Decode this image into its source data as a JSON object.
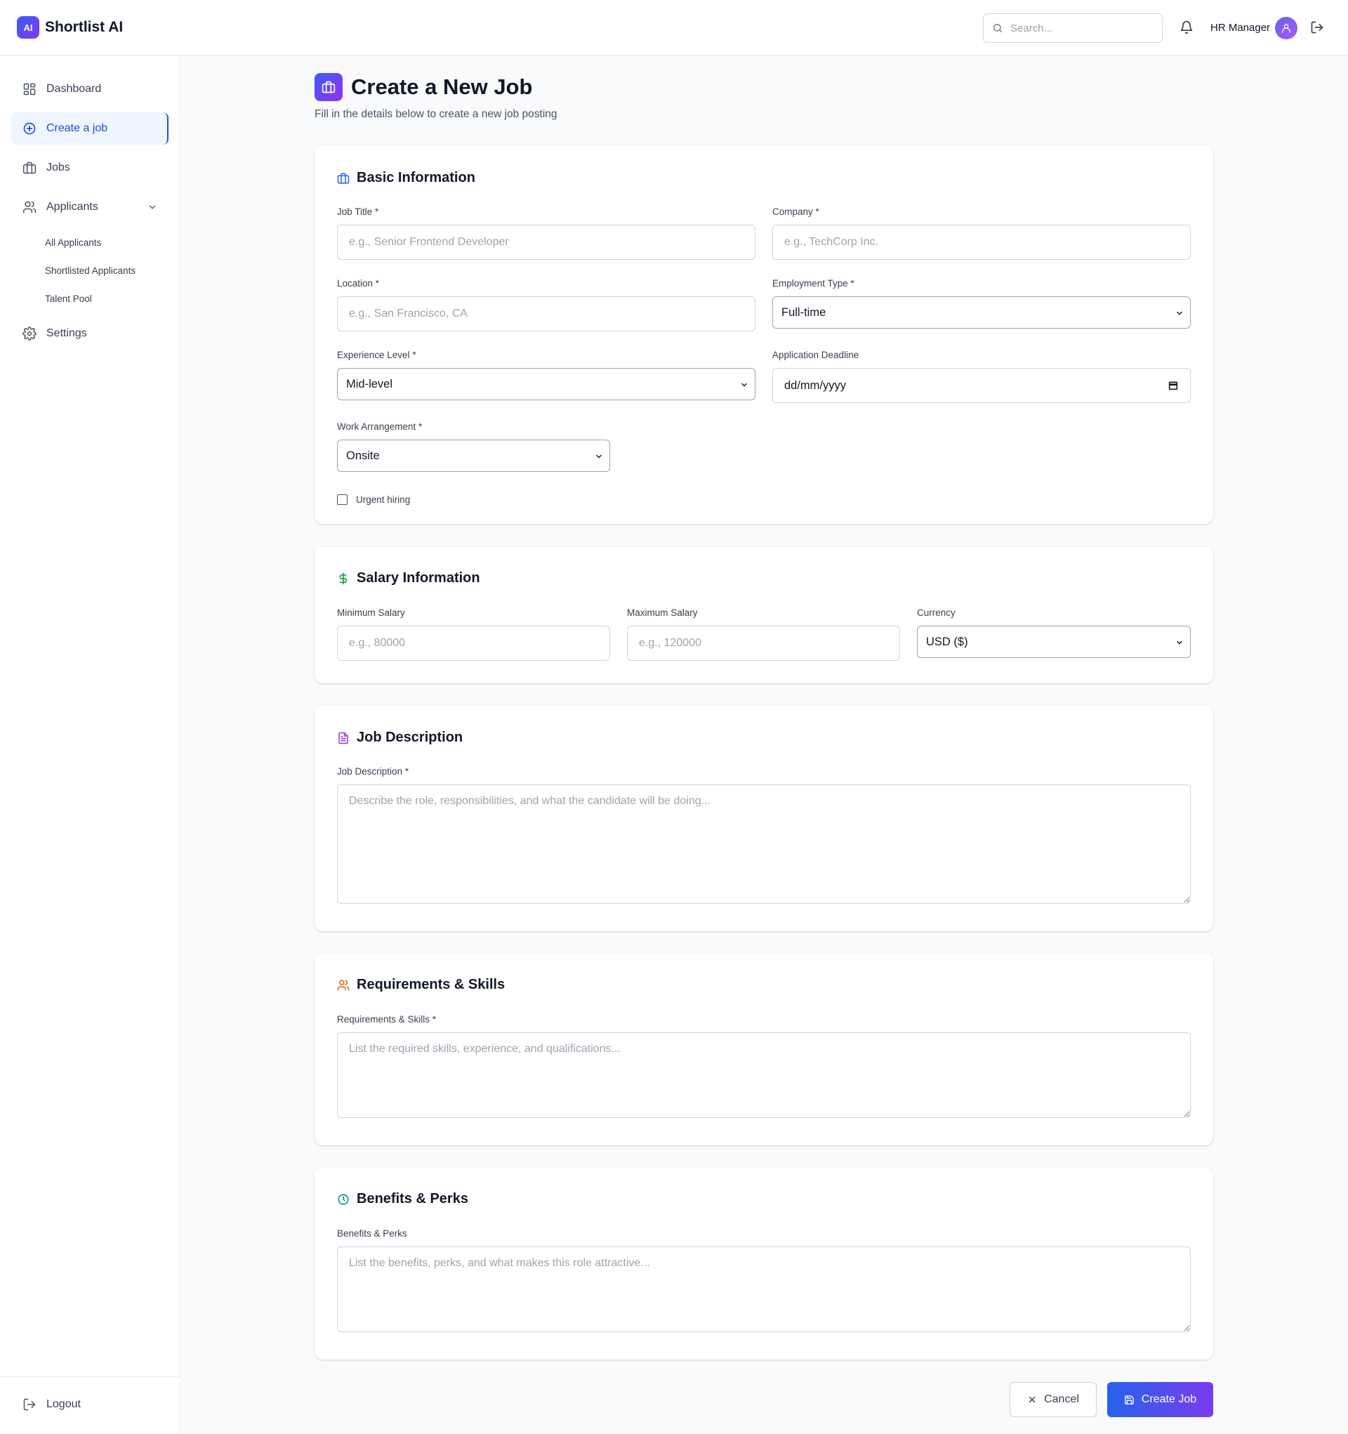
{
  "app": {
    "logo_badge": "AI",
    "name": "Shortlist AI"
  },
  "header": {
    "search_placeholder": "Search...",
    "user_name": "HR Manager"
  },
  "sidebar": {
    "items": [
      {
        "label": "Dashboard",
        "icon": "dashboard-icon"
      },
      {
        "label": "Create a job",
        "icon": "plus-circle-icon",
        "active": true
      },
      {
        "label": "Jobs",
        "icon": "briefcase-icon"
      },
      {
        "label": "Applicants",
        "icon": "users-icon",
        "expanded": true
      },
      {
        "label": "Settings",
        "icon": "gear-icon"
      }
    ],
    "sub_items": [
      "All Applicants",
      "Shortlisted Applicants",
      "Talent Pool"
    ],
    "logout": "Logout"
  },
  "page": {
    "title": "Create a New Job",
    "subtitle": "Fill in the details below to create a new job posting"
  },
  "basic": {
    "title": "Basic Information",
    "job_title_label": "Job Title *",
    "job_title_placeholder": "e.g., Senior Frontend Developer",
    "company_label": "Company *",
    "company_placeholder": "e.g., TechCorp Inc.",
    "location_label": "Location *",
    "location_placeholder": "e.g., San Francisco, CA",
    "employment_label": "Employment Type *",
    "employment_value": "Full-time",
    "experience_label": "Experience Level *",
    "experience_value": "Mid-level",
    "deadline_label": "Application Deadline",
    "deadline_value": "dd/mm/yyyy",
    "arrangement_label": "Work Arrangement *",
    "arrangement_value": "Onsite",
    "urgent_label": "Urgent hiring"
  },
  "salary": {
    "title": "Salary Information",
    "min_label": "Minimum Salary",
    "min_placeholder": "e.g., 80000",
    "max_label": "Maximum Salary",
    "max_placeholder": "e.g., 120000",
    "currency_label": "Currency",
    "currency_value": "USD ($)"
  },
  "description": {
    "title": "Job Description",
    "label": "Job Description *",
    "placeholder": "Describe the role, responsibilities, and what the candidate will be doing..."
  },
  "requirements": {
    "title": "Requirements & Skills",
    "label": "Requirements & Skills *",
    "placeholder": "List the required skills, experience, and qualifications..."
  },
  "benefits": {
    "title": "Benefits & Perks",
    "label": "Benefits & Perks",
    "placeholder": "List the benefits, perks, and what makes this role attractive..."
  },
  "actions": {
    "cancel": "Cancel",
    "create": "Create Job"
  },
  "colors": {
    "primary": "#1d4ed8",
    "gradient_start": "#2563eb",
    "gradient_end": "#7c3aed",
    "salary_icon": "#16a34a",
    "description_icon": "#9333ea",
    "requirements_icon": "#ea580c",
    "benefits_icon": "#0d9488"
  }
}
